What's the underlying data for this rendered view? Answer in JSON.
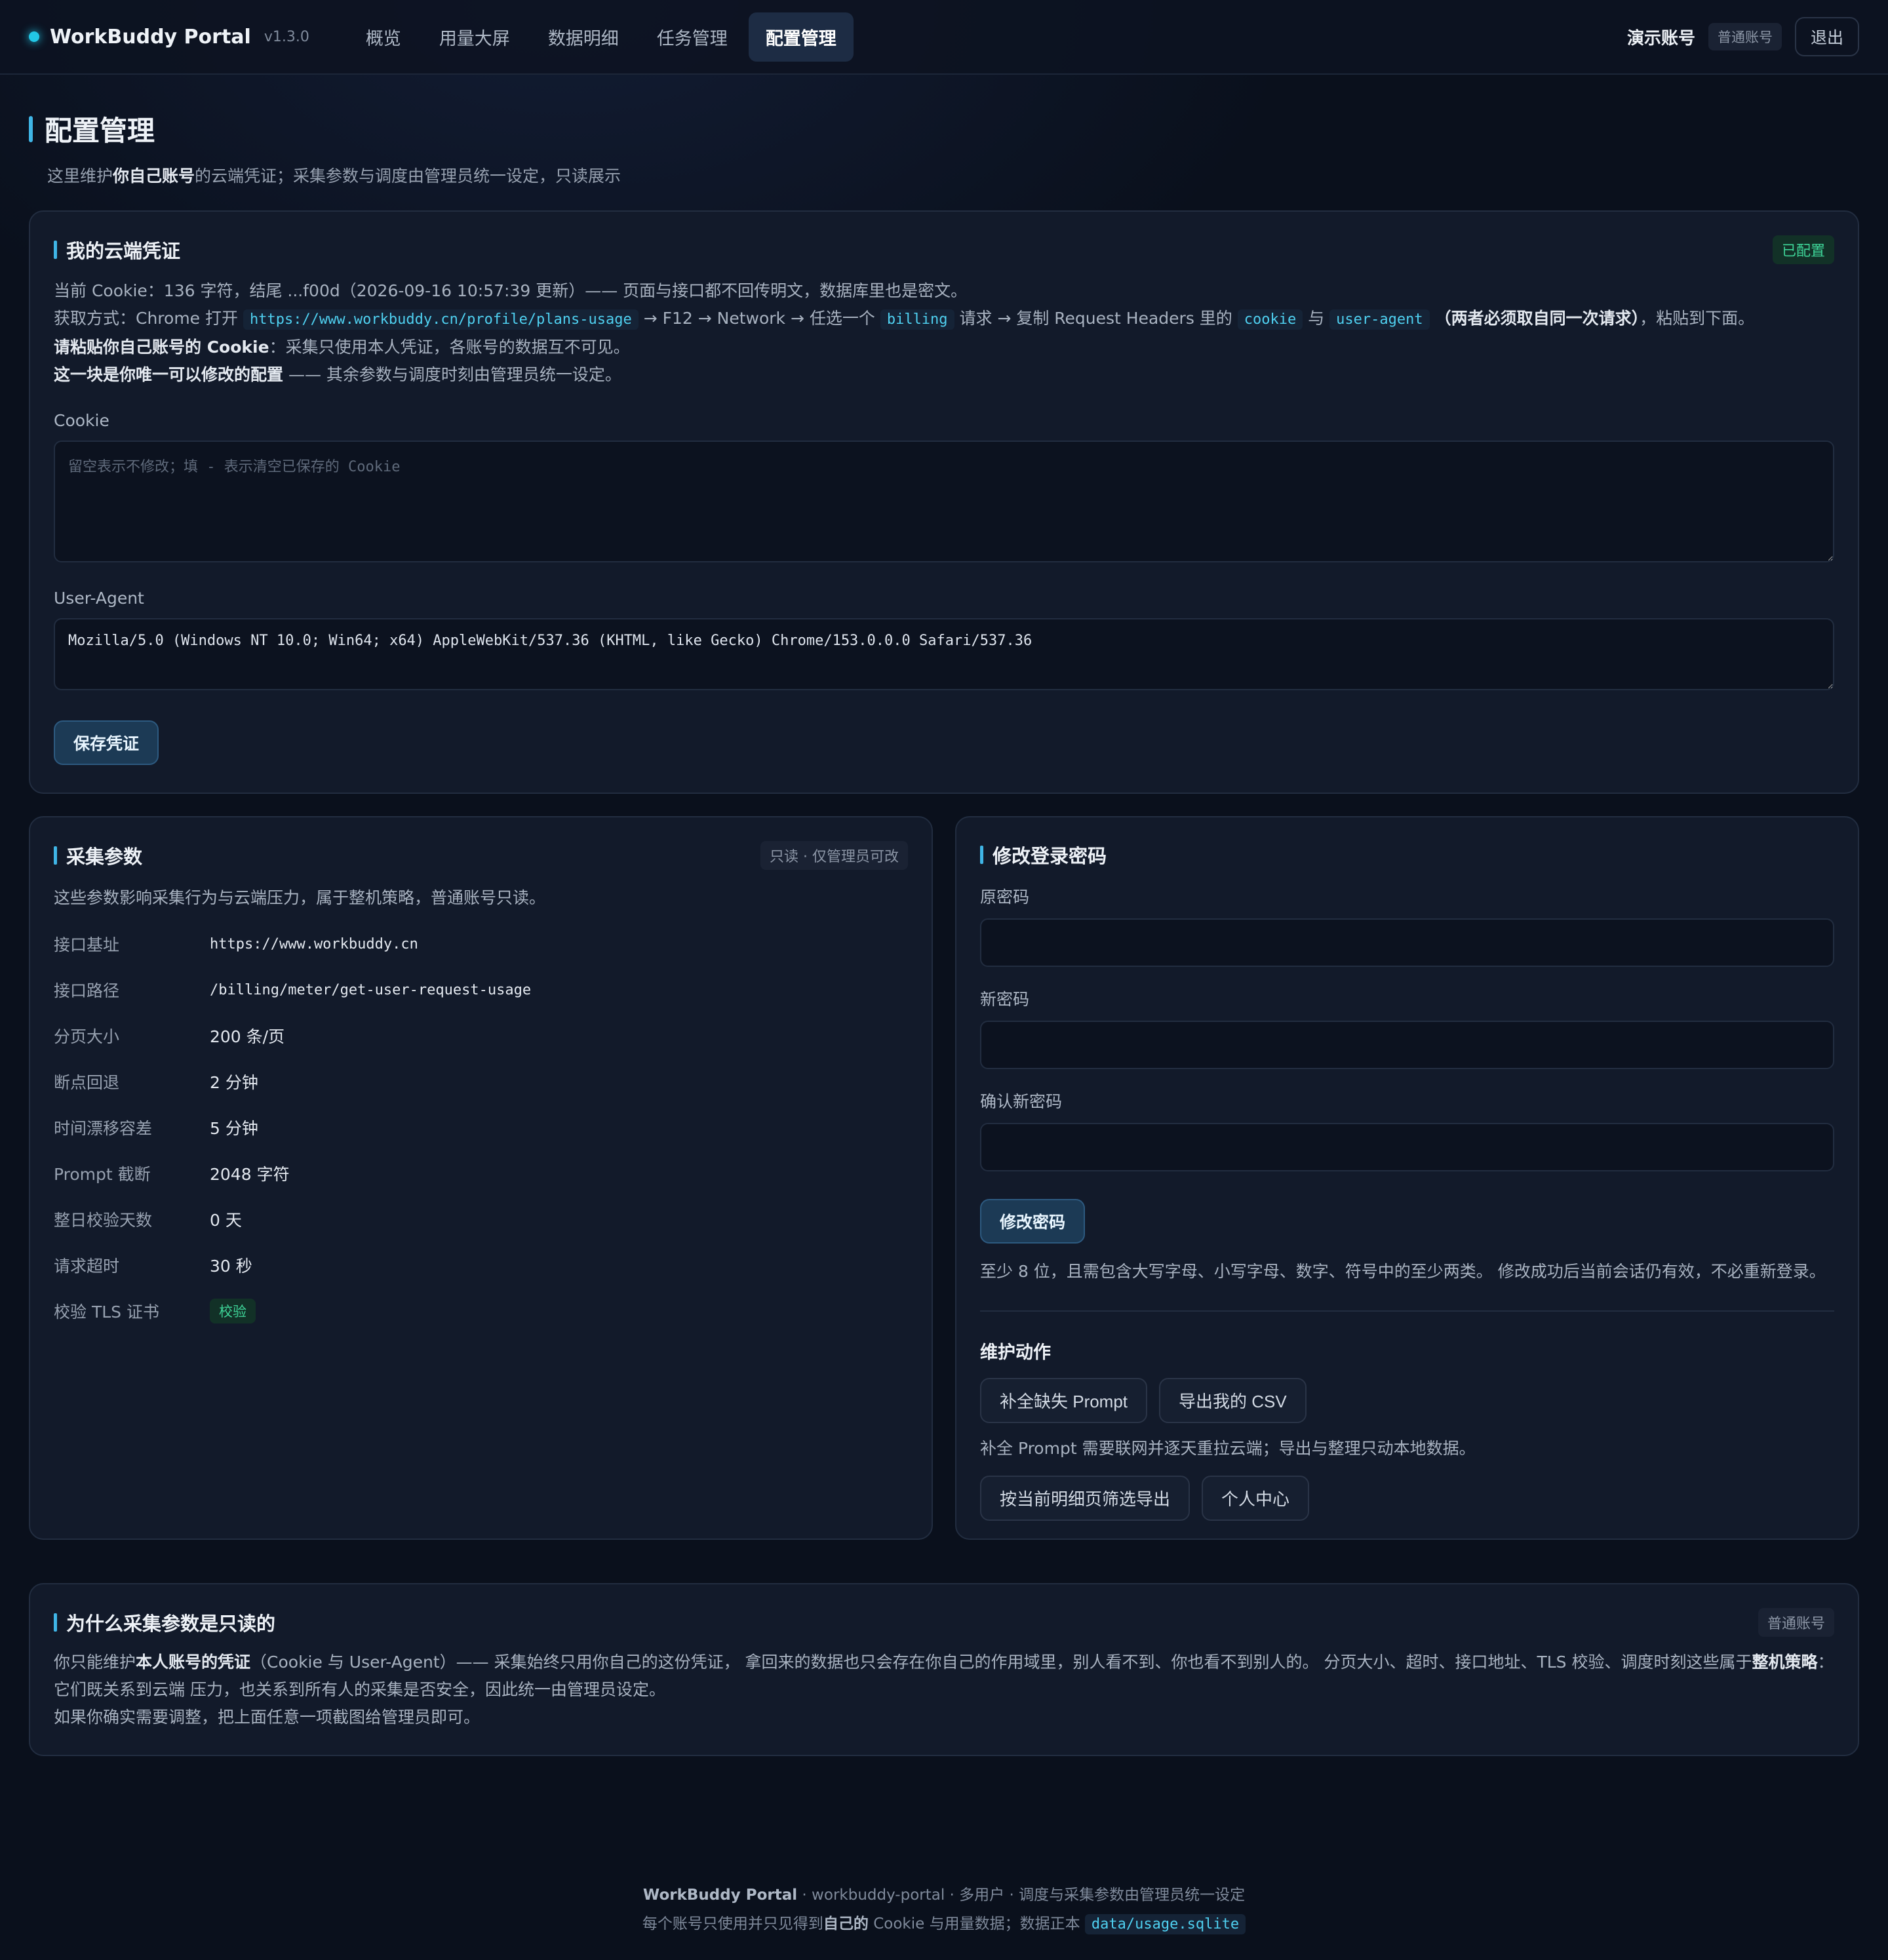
{
  "topbar": {
    "brand": "WorkBuddy Portal",
    "version": "v1.3.0",
    "nav": [
      "概览",
      "用量大屏",
      "数据明细",
      "任务管理",
      "配置管理"
    ],
    "active_index": 4,
    "user": "演示账号",
    "role_badge": "普通账号",
    "logout": "退出"
  },
  "page": {
    "title": "配置管理",
    "subtitle_pre": "这里维护",
    "subtitle_bold": "你自己账号",
    "subtitle_post": "的云端凭证；采集参数与调度由管理员统一设定，只读展示"
  },
  "credentials": {
    "title": "我的云端凭证",
    "status": "已配置",
    "line1": "当前 Cookie：136 字符，结尾 ...f00d（2026-09-16 10:57:39 更新）—— 页面与接口都不回传明文，数据库里也是密文。",
    "line2": {
      "t1": "获取方式：Chrome 打开",
      "c1": "https://www.workbuddy.cn/profile/plans-usage",
      "t2": "→ F12 → Network → 任选一个",
      "c2": "billing",
      "t3": "请求 → 复制 Request Headers 里的",
      "c3": "cookie",
      "t4": "与",
      "c4": "user-agent",
      "b1": "（两者必须取自同一次请求）",
      "t5": "，粘贴到下面。"
    },
    "line3_bold": "请粘贴你自己账号的 Cookie",
    "line3_rest": "：采集只使用本人凭证，各账号的数据互不可见。",
    "line4_bold": "这一块是你唯一可以修改的配置",
    "line4_rest": " —— 其余参数与调度时刻由管理员统一设定。",
    "cookie_label": "Cookie",
    "cookie_placeholder": "留空表示不修改；填 - 表示清空已保存的 Cookie",
    "ua_label": "User-Agent",
    "ua_value": "Mozilla/5.0 (Windows NT 10.0; Win64; x64) AppleWebKit/537.36 (KHTML, like Gecko) Chrome/153.0.0.0 Safari/537.36",
    "save": "保存凭证"
  },
  "collect": {
    "title": "采集参数",
    "badge": "只读 · 仅管理员可改",
    "desc": "这些参数影响采集行为与云端压力，属于整机策略，普通账号只读。",
    "rows": [
      {
        "k": "接口基址",
        "v": "https://www.workbuddy.cn"
      },
      {
        "k": "接口路径",
        "v": "/billing/meter/get-user-request-usage"
      },
      {
        "k": "分页大小",
        "v": "200 条/页"
      },
      {
        "k": "断点回退",
        "v": "2 分钟"
      },
      {
        "k": "时间漂移容差",
        "v": "5 分钟"
      },
      {
        "k": "Prompt 截断",
        "v": "2048 字符"
      },
      {
        "k": "整日校验天数",
        "v": "0 天"
      },
      {
        "k": "请求超时",
        "v": "30 秒"
      },
      {
        "k": "校验 TLS 证书",
        "v": "校验"
      }
    ]
  },
  "password": {
    "title": "修改登录密码",
    "old_label": "原密码",
    "new_label": "新密码",
    "confirm_label": "确认新密码",
    "submit": "修改密码",
    "hint": "至少 8 位，且需包含大写字母、小写字母、数字、符号中的至少两类。 修改成功后当前会话仍有效，不必重新登录。",
    "maint_title": "维护动作",
    "btn_fill": "补全缺失 Prompt",
    "btn_export": "导出我的 CSV",
    "maint_hint": "补全 Prompt 需要联网并逐天重拉云端；导出与整理只动本地数据。",
    "btn_filter_export": "按当前明细页筛选导出",
    "btn_profile": "个人中心"
  },
  "why": {
    "title": "为什么采集参数是只读的",
    "badge": "普通账号",
    "p1_pre": "你只能维护",
    "p1_bold1": "本人账号的凭证",
    "p1_mid": "（Cookie 与 User-Agent）—— 采集始终只用你自己的这份凭证， 拿回来的数据也只会存在你自己的作用域里，别人看不到、你也看不到别人的。 分页大小、超时、接口地址、TLS 校验、调度时刻这些属于",
    "p1_bold2": "整机策略",
    "p1_post": "：它们既关系到云端 压力，也关系到所有人的采集是否安全，因此统一由管理员设定。",
    "p2": "如果你确实需要调整，把上面任意一项截图给管理员即可。"
  },
  "footer": {
    "brand": "WorkBuddy Portal",
    "line1_rest": " · workbuddy-portal · 多用户 · 调度与采集参数由管理员统一设定",
    "line2_pre": "每个账号只使用并只见得到",
    "line2_bold": "自己的",
    "line2_mid": " Cookie 与用量数据；数据正本 ",
    "line2_code": "data/usage.sqlite"
  },
  "colors": {
    "accent": "#3fb5e6",
    "brand_dot": "#22c7e6",
    "ok_green": "#3ed598",
    "background": "#0a101c"
  }
}
